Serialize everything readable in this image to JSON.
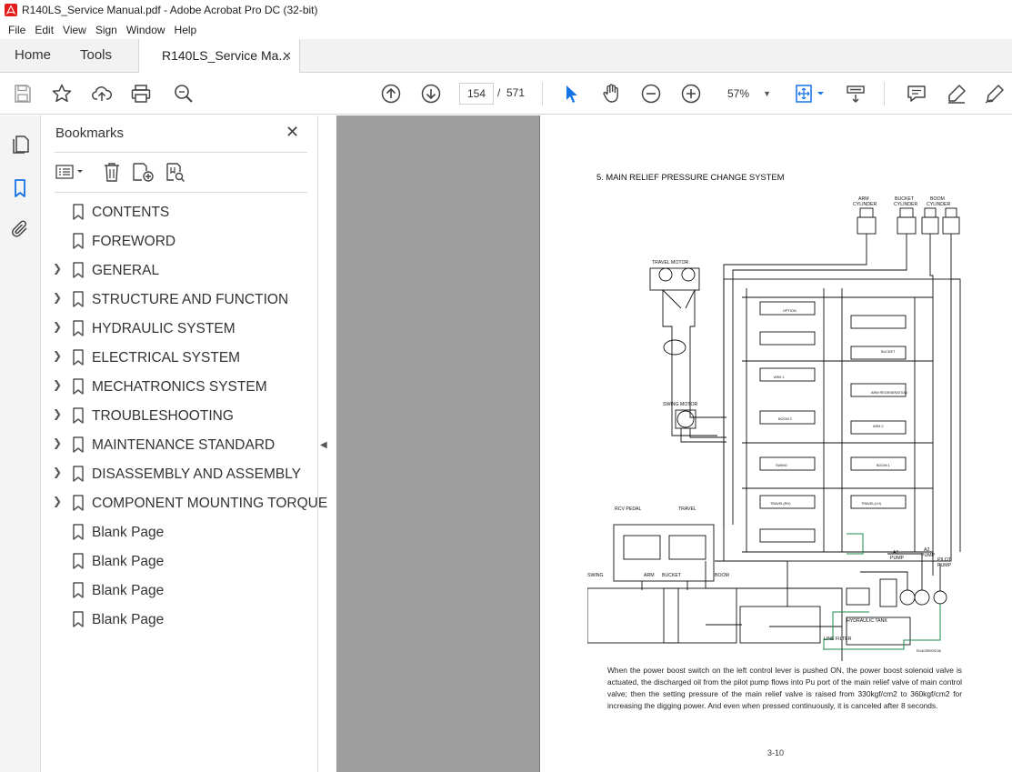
{
  "window": {
    "title": "R140LS_Service Manual.pdf - Adobe Acrobat Pro DC (32-bit)"
  },
  "menu": [
    "File",
    "Edit",
    "View",
    "Sign",
    "Window",
    "Help"
  ],
  "tabs": {
    "home": "Home",
    "tools": "Tools",
    "document": "R140LS_Service Ma...",
    "close": "✕"
  },
  "toolbar": {
    "current_page": "154",
    "separator": "/",
    "total_pages": "571",
    "zoom": "57%"
  },
  "bookmarks": {
    "header": "Bookmarks",
    "close": "✕",
    "items": [
      {
        "label": "CONTENTS",
        "expandable": false
      },
      {
        "label": "FOREWORD",
        "expandable": false
      },
      {
        "label": "GENERAL",
        "expandable": true
      },
      {
        "label": "STRUCTURE AND FUNCTION",
        "expandable": true
      },
      {
        "label": "HYDRAULIC SYSTEM",
        "expandable": true
      },
      {
        "label": "ELECTRICAL SYSTEM",
        "expandable": true
      },
      {
        "label": "MECHATRONICS SYSTEM",
        "expandable": true
      },
      {
        "label": "TROUBLESHOOTING",
        "expandable": true
      },
      {
        "label": "MAINTENANCE STANDARD",
        "expandable": true
      },
      {
        "label": "DISASSEMBLY AND ASSEMBLY",
        "expandable": true
      },
      {
        "label": "COMPONENT MOUNTING TORQUE",
        "expandable": true
      },
      {
        "label": "Blank Page",
        "expandable": false
      },
      {
        "label": "Blank Page",
        "expandable": false
      },
      {
        "label": "Blank Page",
        "expandable": false
      },
      {
        "label": "Blank Page",
        "expandable": false
      }
    ]
  },
  "document": {
    "heading": "5. MAIN RELIEF PRESSURE CHANGE SYSTEM",
    "body": "When the power boost switch on the left control lever is pushed ON, the power boost solenoid valve is actuated, the discharged oil from the pilot pump flows into Pu port of the main relief valve of main control valve; then the setting pressure of the main relief valve is raised from 330kgf/cm2 to 360kgf/cm2 for increasing the digging power.    And even when pressed continuously, it is canceled after 8 seconds.",
    "page_number": "3-10",
    "diagram_labels": {
      "arm_cylinder": [
        "ARM",
        "CYLINDER"
      ],
      "bucket_cylinder": [
        "BUCKET",
        "CYLINDER"
      ],
      "boom_cylinder": [
        "BOOM",
        "CYLINDER"
      ],
      "travel_motor": "TRAVEL MOTOR",
      "swing_motor": "SWING MOTOR",
      "rcv_pedal": "RCV PEDAL",
      "travel": "TRAVEL",
      "swing": "SWING",
      "arm": "ARM",
      "bucket": "BUCKET",
      "boom": "BOOM",
      "a1_pump": [
        "A1",
        "PUMP"
      ],
      "a2_pump": [
        "A2",
        "PUMP"
      ],
      "pilot_pump": [
        "PILOT",
        "PUMP"
      ],
      "hydraulic_tank": "HYDRAULIC TANK",
      "line_filter": "LINE FILTER",
      "option": "OPTION",
      "bucket_spool": "BUCKET",
      "arm1": "ARM 1",
      "arm_regen": "ARM REGENERATION",
      "arm2": "ARM 2",
      "boom2": "BOOM 2",
      "swing_spool": "SWING",
      "boom1": "BOOM 1",
      "travel_rh": "TRAVEL(RH)",
      "travel_lh": "TRAVEL(LH)",
      "drawing_code": "R1403SH3C06"
    }
  }
}
